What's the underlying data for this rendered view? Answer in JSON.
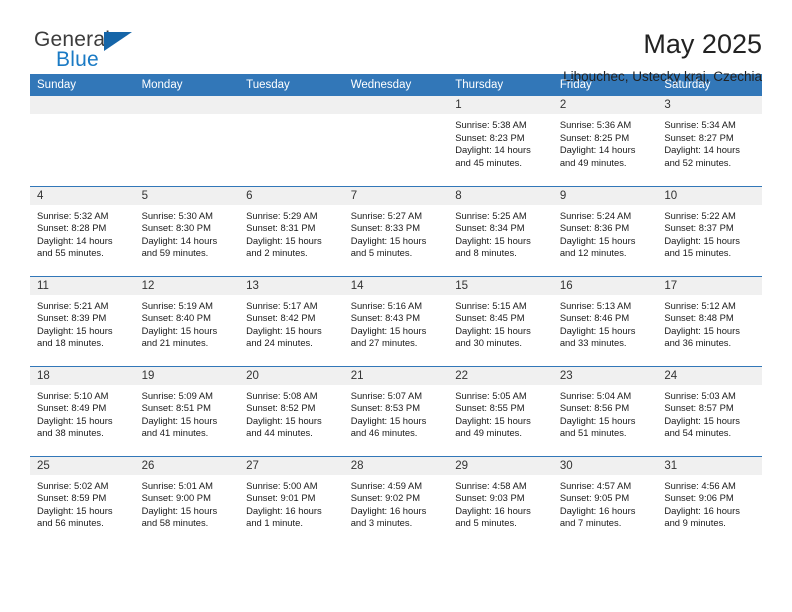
{
  "brand": {
    "name_part1": "General",
    "name_part2": "Blue",
    "accent_color": "#1a7ac4"
  },
  "header": {
    "title": "May 2025",
    "subtitle": "Libouchec, Ustecky kraj, Czechia"
  },
  "theme": {
    "header_blue": "#3277b8",
    "daynum_band": "#f0f0f0"
  },
  "calendar": {
    "weekday_headers": [
      "Sunday",
      "Monday",
      "Tuesday",
      "Wednesday",
      "Thursday",
      "Friday",
      "Saturday"
    ],
    "weeks": [
      [
        {
          "day": "",
          "empty": true,
          "sunrise": "",
          "sunset": "",
          "daylight1": "",
          "daylight2": ""
        },
        {
          "day": "",
          "empty": true,
          "sunrise": "",
          "sunset": "",
          "daylight1": "",
          "daylight2": ""
        },
        {
          "day": "",
          "empty": true,
          "sunrise": "",
          "sunset": "",
          "daylight1": "",
          "daylight2": ""
        },
        {
          "day": "",
          "empty": true,
          "sunrise": "",
          "sunset": "",
          "daylight1": "",
          "daylight2": ""
        },
        {
          "day": "1",
          "sunrise": "Sunrise: 5:38 AM",
          "sunset": "Sunset: 8:23 PM",
          "daylight1": "Daylight: 14 hours",
          "daylight2": "and 45 minutes."
        },
        {
          "day": "2",
          "sunrise": "Sunrise: 5:36 AM",
          "sunset": "Sunset: 8:25 PM",
          "daylight1": "Daylight: 14 hours",
          "daylight2": "and 49 minutes."
        },
        {
          "day": "3",
          "sunrise": "Sunrise: 5:34 AM",
          "sunset": "Sunset: 8:27 PM",
          "daylight1": "Daylight: 14 hours",
          "daylight2": "and 52 minutes."
        }
      ],
      [
        {
          "day": "4",
          "sunrise": "Sunrise: 5:32 AM",
          "sunset": "Sunset: 8:28 PM",
          "daylight1": "Daylight: 14 hours",
          "daylight2": "and 55 minutes."
        },
        {
          "day": "5",
          "sunrise": "Sunrise: 5:30 AM",
          "sunset": "Sunset: 8:30 PM",
          "daylight1": "Daylight: 14 hours",
          "daylight2": "and 59 minutes."
        },
        {
          "day": "6",
          "sunrise": "Sunrise: 5:29 AM",
          "sunset": "Sunset: 8:31 PM",
          "daylight1": "Daylight: 15 hours",
          "daylight2": "and 2 minutes."
        },
        {
          "day": "7",
          "sunrise": "Sunrise: 5:27 AM",
          "sunset": "Sunset: 8:33 PM",
          "daylight1": "Daylight: 15 hours",
          "daylight2": "and 5 minutes."
        },
        {
          "day": "8",
          "sunrise": "Sunrise: 5:25 AM",
          "sunset": "Sunset: 8:34 PM",
          "daylight1": "Daylight: 15 hours",
          "daylight2": "and 8 minutes."
        },
        {
          "day": "9",
          "sunrise": "Sunrise: 5:24 AM",
          "sunset": "Sunset: 8:36 PM",
          "daylight1": "Daylight: 15 hours",
          "daylight2": "and 12 minutes."
        },
        {
          "day": "10",
          "sunrise": "Sunrise: 5:22 AM",
          "sunset": "Sunset: 8:37 PM",
          "daylight1": "Daylight: 15 hours",
          "daylight2": "and 15 minutes."
        }
      ],
      [
        {
          "day": "11",
          "sunrise": "Sunrise: 5:21 AM",
          "sunset": "Sunset: 8:39 PM",
          "daylight1": "Daylight: 15 hours",
          "daylight2": "and 18 minutes."
        },
        {
          "day": "12",
          "sunrise": "Sunrise: 5:19 AM",
          "sunset": "Sunset: 8:40 PM",
          "daylight1": "Daylight: 15 hours",
          "daylight2": "and 21 minutes."
        },
        {
          "day": "13",
          "sunrise": "Sunrise: 5:17 AM",
          "sunset": "Sunset: 8:42 PM",
          "daylight1": "Daylight: 15 hours",
          "daylight2": "and 24 minutes."
        },
        {
          "day": "14",
          "sunrise": "Sunrise: 5:16 AM",
          "sunset": "Sunset: 8:43 PM",
          "daylight1": "Daylight: 15 hours",
          "daylight2": "and 27 minutes."
        },
        {
          "day": "15",
          "sunrise": "Sunrise: 5:15 AM",
          "sunset": "Sunset: 8:45 PM",
          "daylight1": "Daylight: 15 hours",
          "daylight2": "and 30 minutes."
        },
        {
          "day": "16",
          "sunrise": "Sunrise: 5:13 AM",
          "sunset": "Sunset: 8:46 PM",
          "daylight1": "Daylight: 15 hours",
          "daylight2": "and 33 minutes."
        },
        {
          "day": "17",
          "sunrise": "Sunrise: 5:12 AM",
          "sunset": "Sunset: 8:48 PM",
          "daylight1": "Daylight: 15 hours",
          "daylight2": "and 36 minutes."
        }
      ],
      [
        {
          "day": "18",
          "sunrise": "Sunrise: 5:10 AM",
          "sunset": "Sunset: 8:49 PM",
          "daylight1": "Daylight: 15 hours",
          "daylight2": "and 38 minutes."
        },
        {
          "day": "19",
          "sunrise": "Sunrise: 5:09 AM",
          "sunset": "Sunset: 8:51 PM",
          "daylight1": "Daylight: 15 hours",
          "daylight2": "and 41 minutes."
        },
        {
          "day": "20",
          "sunrise": "Sunrise: 5:08 AM",
          "sunset": "Sunset: 8:52 PM",
          "daylight1": "Daylight: 15 hours",
          "daylight2": "and 44 minutes."
        },
        {
          "day": "21",
          "sunrise": "Sunrise: 5:07 AM",
          "sunset": "Sunset: 8:53 PM",
          "daylight1": "Daylight: 15 hours",
          "daylight2": "and 46 minutes."
        },
        {
          "day": "22",
          "sunrise": "Sunrise: 5:05 AM",
          "sunset": "Sunset: 8:55 PM",
          "daylight1": "Daylight: 15 hours",
          "daylight2": "and 49 minutes."
        },
        {
          "day": "23",
          "sunrise": "Sunrise: 5:04 AM",
          "sunset": "Sunset: 8:56 PM",
          "daylight1": "Daylight: 15 hours",
          "daylight2": "and 51 minutes."
        },
        {
          "day": "24",
          "sunrise": "Sunrise: 5:03 AM",
          "sunset": "Sunset: 8:57 PM",
          "daylight1": "Daylight: 15 hours",
          "daylight2": "and 54 minutes."
        }
      ],
      [
        {
          "day": "25",
          "sunrise": "Sunrise: 5:02 AM",
          "sunset": "Sunset: 8:59 PM",
          "daylight1": "Daylight: 15 hours",
          "daylight2": "and 56 minutes."
        },
        {
          "day": "26",
          "sunrise": "Sunrise: 5:01 AM",
          "sunset": "Sunset: 9:00 PM",
          "daylight1": "Daylight: 15 hours",
          "daylight2": "and 58 minutes."
        },
        {
          "day": "27",
          "sunrise": "Sunrise: 5:00 AM",
          "sunset": "Sunset: 9:01 PM",
          "daylight1": "Daylight: 16 hours",
          "daylight2": "and 1 minute."
        },
        {
          "day": "28",
          "sunrise": "Sunrise: 4:59 AM",
          "sunset": "Sunset: 9:02 PM",
          "daylight1": "Daylight: 16 hours",
          "daylight2": "and 3 minutes."
        },
        {
          "day": "29",
          "sunrise": "Sunrise: 4:58 AM",
          "sunset": "Sunset: 9:03 PM",
          "daylight1": "Daylight: 16 hours",
          "daylight2": "and 5 minutes."
        },
        {
          "day": "30",
          "sunrise": "Sunrise: 4:57 AM",
          "sunset": "Sunset: 9:05 PM",
          "daylight1": "Daylight: 16 hours",
          "daylight2": "and 7 minutes."
        },
        {
          "day": "31",
          "sunrise": "Sunrise: 4:56 AM",
          "sunset": "Sunset: 9:06 PM",
          "daylight1": "Daylight: 16 hours",
          "daylight2": "and 9 minutes."
        }
      ]
    ]
  }
}
